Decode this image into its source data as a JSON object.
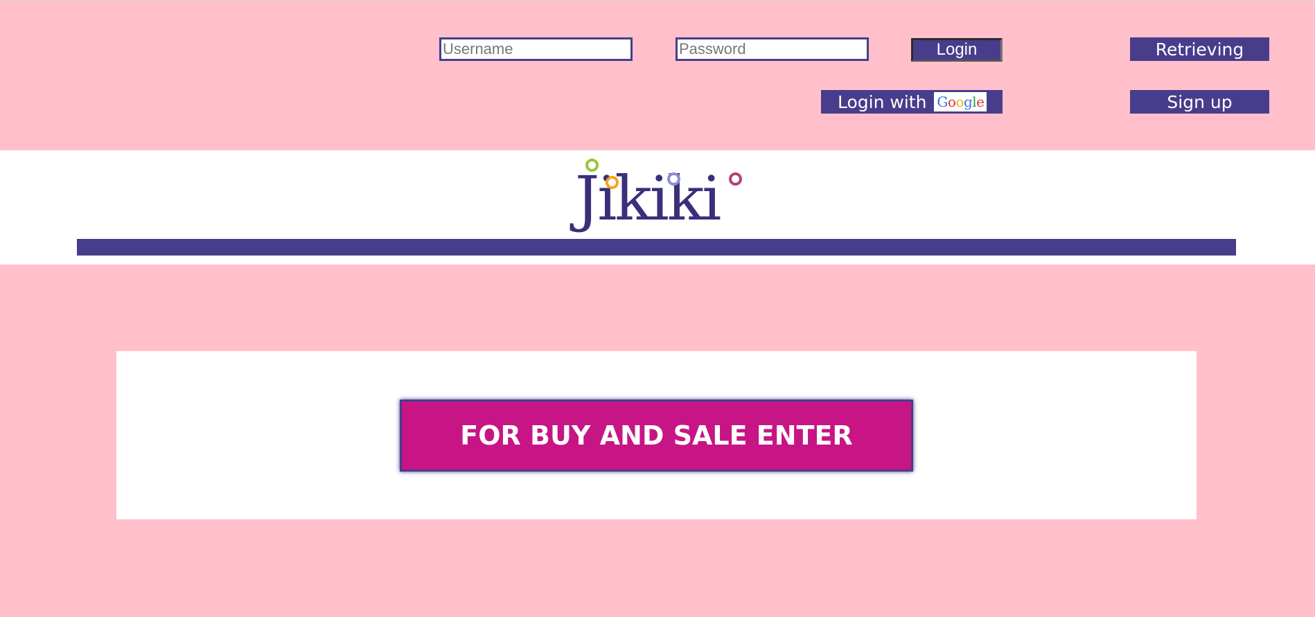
{
  "auth": {
    "username_placeholder": "Username",
    "password_placeholder": "Password",
    "login_label": "Login",
    "retrieving_label": "Retrieving",
    "login_with_label": "Login with",
    "google_wordmark": [
      "G",
      "o",
      "o",
      "g",
      "l",
      "e"
    ],
    "signup_label": "Sign up"
  },
  "brand": {
    "logo_text": "Jikiki",
    "logo_dot_colors": [
      "#9bc53d",
      "#f7a21b",
      "#8a8fd1",
      "#b5407a"
    ]
  },
  "main": {
    "enter_label": "FOR BUY AND SALE ENTER"
  },
  "colors": {
    "background_pink": "#ffc0cb",
    "accent_purple": "#483d8b",
    "enter_magenta": "#c71585"
  }
}
